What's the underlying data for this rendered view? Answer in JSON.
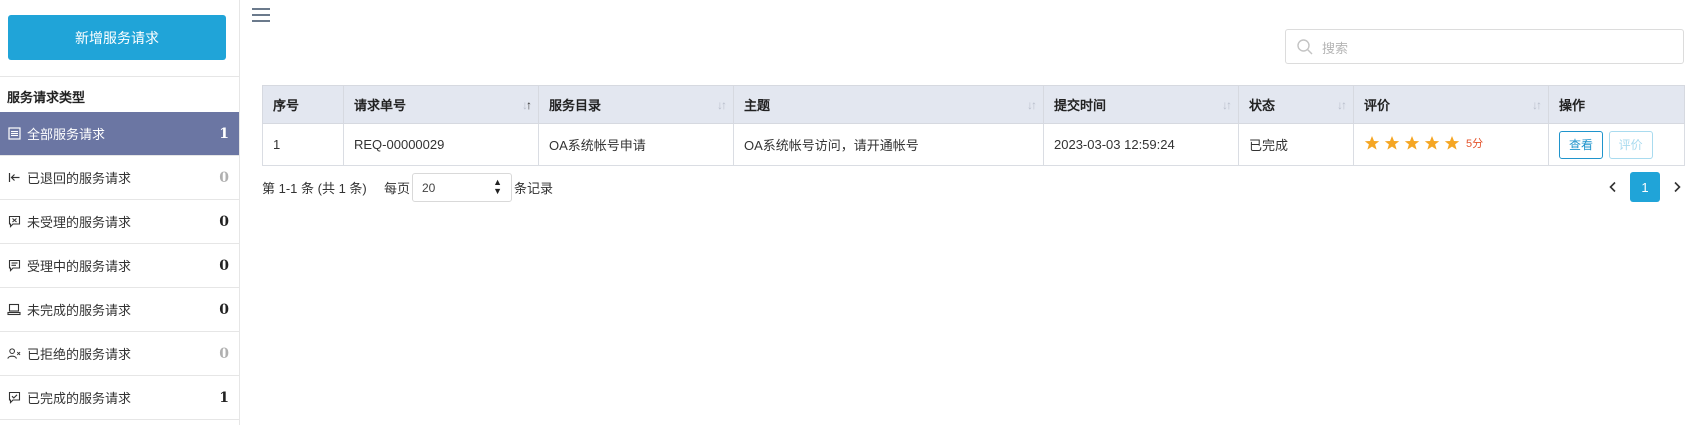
{
  "sidebar": {
    "new_button": "新增服务请求",
    "section_title": "服务请求类型",
    "items": [
      {
        "label": "全部服务请求",
        "count": "1",
        "icon": "document-list-icon",
        "active": true
      },
      {
        "label": "已退回的服务请求",
        "count": "0",
        "icon": "return-arrow-icon"
      },
      {
        "label": "未受理的服务请求",
        "count": "0",
        "icon": "message-x-icon"
      },
      {
        "label": "受理中的服务请求",
        "count": "0",
        "icon": "message-lines-icon"
      },
      {
        "label": "未完成的服务请求",
        "count": "0",
        "icon": "computer-icon"
      },
      {
        "label": "已拒绝的服务请求",
        "count": "0",
        "icon": "user-x-icon"
      },
      {
        "label": "已完成的服务请求",
        "count": "1",
        "icon": "message-check-icon"
      }
    ]
  },
  "search": {
    "placeholder": "搜索"
  },
  "table": {
    "columns": [
      "序号",
      "请求单号",
      "服务目录",
      "主题",
      "提交时间",
      "状态",
      "评价",
      "操作"
    ],
    "rows": [
      {
        "index": "1",
        "request_no": "REQ-00000029",
        "catalog": "OA系统帐号申请",
        "subject": "OA系统帐号访问，请开通帐号",
        "submit_time": "2023-03-03 12:59:24",
        "status": "已完成",
        "rating_stars": 5,
        "rating_text": "5分",
        "actions": [
          "查看",
          "评价"
        ]
      }
    ]
  },
  "pagination": {
    "info": "第 1-1 条 (共 1 条)",
    "per_page_label": "每页",
    "per_page_value": "20",
    "records_label": "条记录",
    "current_page": "1"
  },
  "colors": {
    "primary": "#20a4d8",
    "sidebar_active": "#6b76a3",
    "status_done": "#2a9d3a",
    "star": "#f5a623",
    "score": "#e4542c"
  }
}
